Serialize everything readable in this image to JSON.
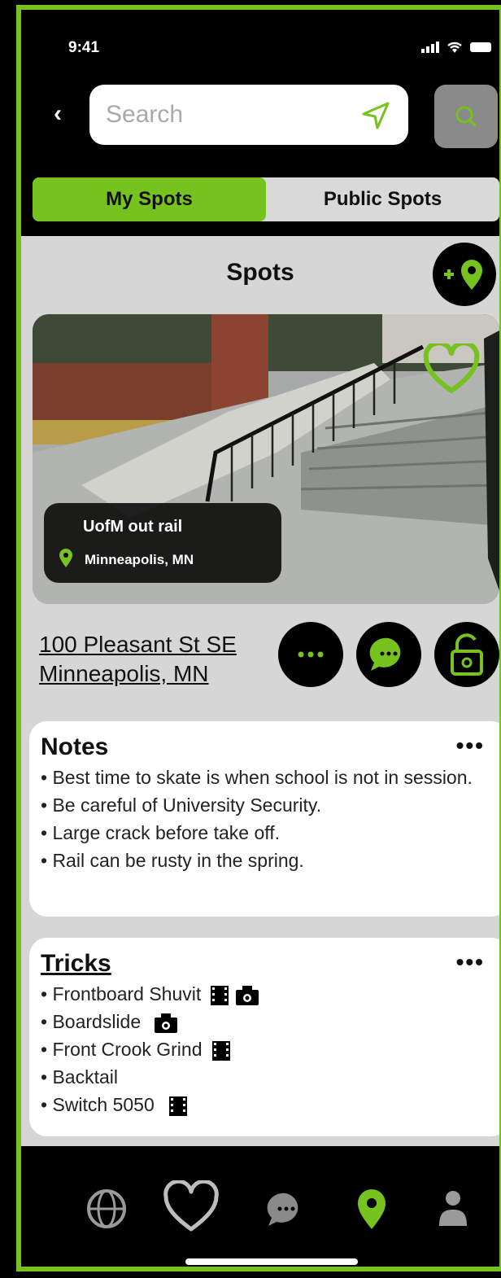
{
  "status": {
    "time": "9:41"
  },
  "search": {
    "placeholder": "Search"
  },
  "tabs": {
    "my_spots": "My Spots",
    "public_spots": "Public Spots",
    "active": "my_spots"
  },
  "page": {
    "title": "Spots"
  },
  "spot": {
    "name": "UofM out rail",
    "location": "Minneapolis, MN",
    "address_line1": "100 Pleasant St SE",
    "address_line2": "Minneapolis, MN"
  },
  "notes": {
    "title": "Notes",
    "more": "•••",
    "items": [
      "• Best time to skate is when school is not in session.",
      "• Be careful of University Security.",
      "• Large crack before take off.",
      "• Rail can be rusty in the spring."
    ]
  },
  "tricks": {
    "title": "Tricks",
    "more": "•••",
    "items": [
      {
        "label": "• Frontboard Shuvit",
        "icons": [
          "film-icon",
          "camera-icon"
        ]
      },
      {
        "label": "• Boardslide",
        "icons": [
          "camera-icon"
        ]
      },
      {
        "label": "• Front Crook Grind",
        "icons": [
          "film-icon"
        ]
      },
      {
        "label": "• Backtail",
        "icons": []
      },
      {
        "label": "• Switch 5050",
        "icons": [
          "film-icon"
        ]
      }
    ]
  },
  "tabbar": [
    "globe-icon",
    "heart-icon",
    "chat-icon",
    "map-pin-icon",
    "profile-icon"
  ],
  "colors": {
    "accent": "#76c21f",
    "background": "#d6d6d6",
    "dark": "#000000"
  }
}
